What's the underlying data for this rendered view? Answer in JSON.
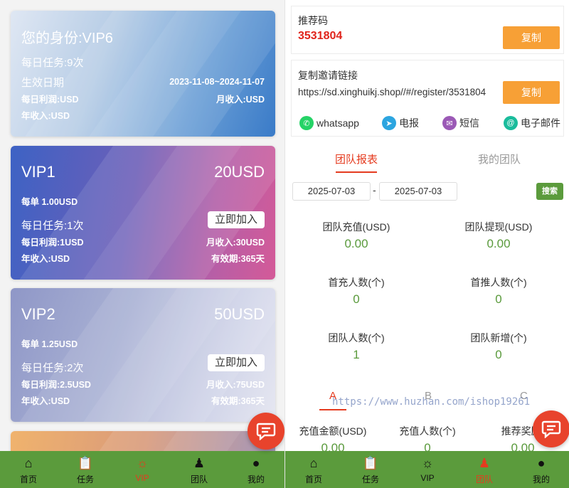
{
  "vip_page": {
    "current": {
      "identity": "您的身份:VIP6",
      "daily_tasks": "每日任务:9次",
      "effective_label": "生效日期",
      "effective_range": "2023-11-08~2024-11-07",
      "daily_profit": "每日利润:USD",
      "monthly_income": "月收入:USD",
      "annual_income": "年收入:USD"
    },
    "levels": [
      {
        "name": "VIP1",
        "price": "20USD",
        "per_order": "每单 1.00USD",
        "daily_tasks": "每日任务:1次",
        "join": "立即加入",
        "daily_profit": "每日利润:1USD",
        "monthly_income": "月收入:30USD",
        "annual_income": "年收入:USD",
        "validity": "有效期:365天"
      },
      {
        "name": "VIP2",
        "price": "50USD",
        "per_order": "每单 1.25USD",
        "daily_tasks": "每日任务:2次",
        "join": "立即加入",
        "daily_profit": "每日利润:2.5USD",
        "monthly_income": "月收入:75USD",
        "annual_income": "年收入:USD",
        "validity": "有效期:365天"
      }
    ],
    "nav": [
      {
        "label": "首页",
        "icon": "home-icon",
        "active": false
      },
      {
        "label": "任务",
        "icon": "clipboard-icon",
        "active": false
      },
      {
        "label": "VIP",
        "icon": "vip-icon",
        "active": true
      },
      {
        "label": "团队",
        "icon": "team-icon",
        "active": false
      },
      {
        "label": "我的",
        "icon": "user-icon",
        "active": false
      }
    ]
  },
  "team_page": {
    "referral_label": "推荐码",
    "referral_code": "3531804",
    "copy_label": "复制",
    "invite_label": "复制邀请链接",
    "invite_link": "https://sd.xinghuikj.shop//#/register/3531804",
    "share": [
      {
        "label": "whatsapp",
        "icon": "whatsapp-icon",
        "color": "#25d366"
      },
      {
        "label": "电报",
        "icon": "telegram-icon",
        "color": "#2ca5e0"
      },
      {
        "label": "短信",
        "icon": "sms-icon",
        "color": "#9b59b6"
      },
      {
        "label": "电子邮件",
        "icon": "email-icon",
        "color": "#1abc9c"
      }
    ],
    "tabs": {
      "report": "团队报表",
      "my_team": "我的团队"
    },
    "date_from": "2025-07-03",
    "date_to": "2025-07-03",
    "date_sep": "-",
    "search": "搜索",
    "stats": [
      {
        "label": "团队充值(USD)",
        "value": "0.00"
      },
      {
        "label": "团队提现(USD)",
        "value": "0.00"
      },
      {
        "label": "首充人数(个)",
        "value": "0"
      },
      {
        "label": "首推人数(个)",
        "value": "0"
      },
      {
        "label": "团队人数(个)",
        "value": "1"
      },
      {
        "label": "团队新增(个)",
        "value": "0"
      }
    ],
    "level_tabs": [
      "A",
      "B",
      "C"
    ],
    "level_stats": [
      {
        "label": "充值金额(USD)",
        "value": "0.00"
      },
      {
        "label": "充值人数(个)",
        "value": "0"
      },
      {
        "label": "推荐奖励(",
        "value": "0.00"
      }
    ],
    "watermark": "https://www.huzhan.com/ishop19261",
    "nav": [
      {
        "label": "首页",
        "icon": "home-icon",
        "active": false
      },
      {
        "label": "任务",
        "icon": "clipboard-icon",
        "active": false
      },
      {
        "label": "VIP",
        "icon": "vip-icon",
        "active": false
      },
      {
        "label": "团队",
        "icon": "team-icon",
        "active": true
      },
      {
        "label": "我的",
        "icon": "user-icon",
        "active": false
      }
    ]
  },
  "colors": {
    "accent_red": "#e53b1f",
    "nav_green": "#5b9b3c",
    "value_green": "#5a9a3c",
    "copy_orange": "#f7a036"
  }
}
